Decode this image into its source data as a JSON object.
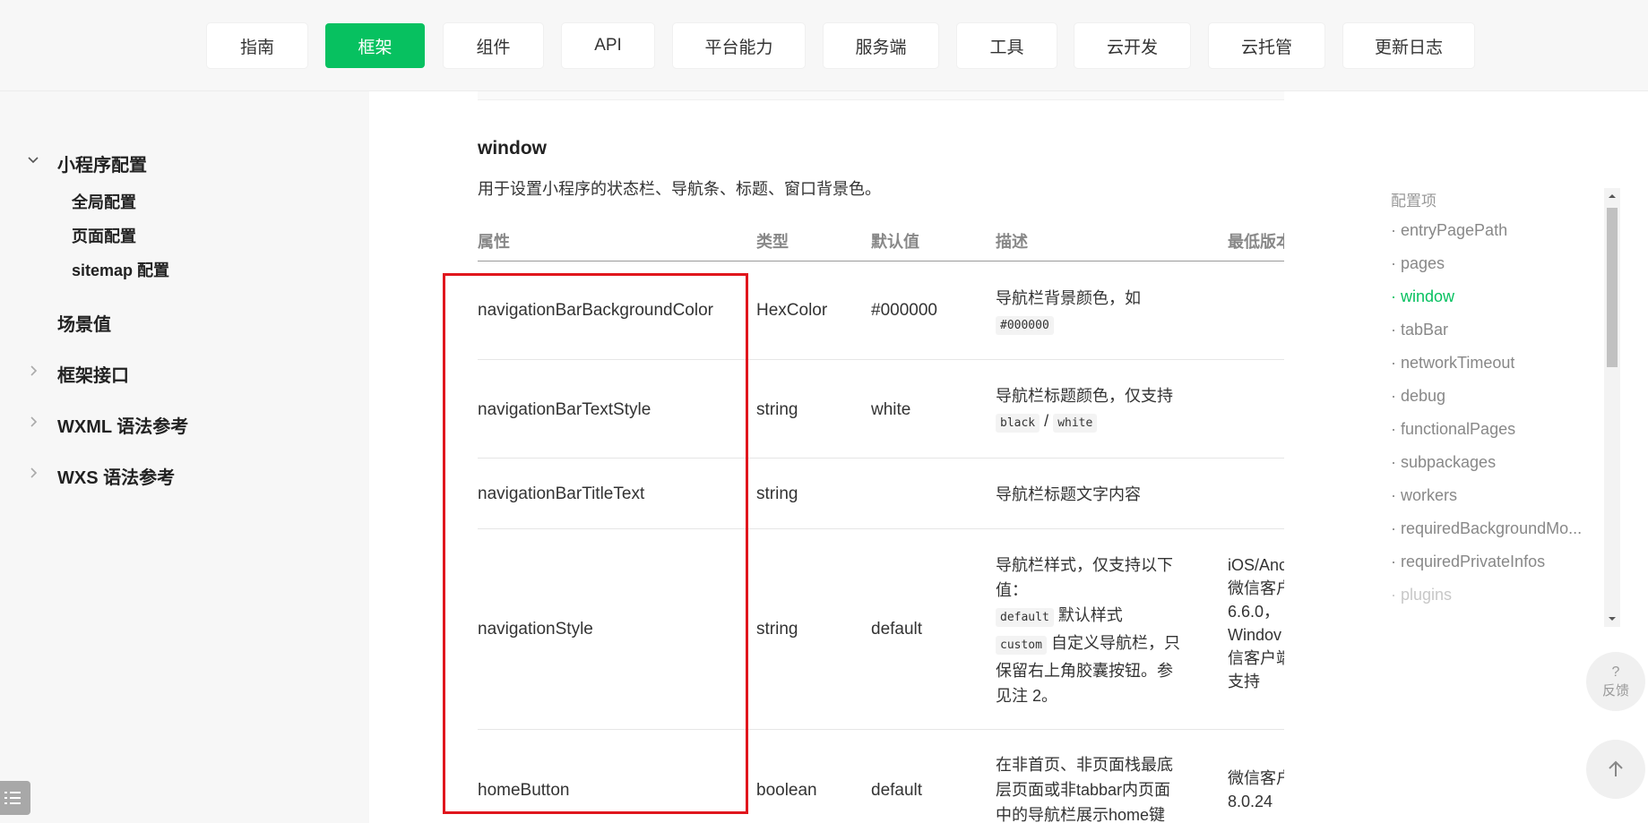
{
  "topnav": {
    "tabs": [
      "指南",
      "框架",
      "组件",
      "API",
      "平台能力",
      "服务端",
      "工具",
      "云开发",
      "云托管",
      "更新日志"
    ],
    "active_tab": "框架",
    "accent_color": "#07c160"
  },
  "sidebar": {
    "group_title": "小程序配置",
    "sub_items": [
      "全局配置",
      "页面配置",
      "sitemap 配置"
    ],
    "items": [
      "场景值",
      "框架接口",
      "WXML 语法参考",
      "WXS 语法参考"
    ]
  },
  "section": {
    "title": "window",
    "description": "用于设置小程序的状态栏、导航条、标题、窗口背景色。"
  },
  "table": {
    "headers": [
      "属性",
      "类型",
      "默认值",
      "描述",
      "最低版本"
    ],
    "rows": [
      {
        "prop": "navigationBarBackgroundColor",
        "type": "HexColor",
        "default": "#000000",
        "desc_text": "导航栏背景颜色，如",
        "desc_code": "#000000"
      },
      {
        "prop": "navigationBarTextStyle",
        "type": "string",
        "default": "white",
        "desc_text": "导航栏标题颜色，仅支持",
        "desc_code1": "black",
        "desc_sep": "/",
        "desc_code2": "white"
      },
      {
        "prop": "navigationBarTitleText",
        "type": "string",
        "default": "",
        "desc_text": "导航栏标题文字内容"
      },
      {
        "prop": "navigationStyle",
        "type": "string",
        "default": "default",
        "desc_line1": "导航栏样式，仅支持以下",
        "desc_line2": "值：",
        "code_default": "default",
        "desc_default": "默认样式",
        "code_custom": "custom",
        "desc_custom": "自定义导航栏，只",
        "desc_line5": "保留右上角胶囊按钮。参",
        "desc_line6": "见注 2。",
        "version_lines": [
          "iOS/Anc",
          "微信客户",
          "6.6.0，",
          "Windov",
          "信客户端",
          "支持"
        ]
      },
      {
        "prop": "homeButton",
        "type": "boolean",
        "default": "default",
        "desc_lines": [
          "在非首页、非页面栈最底",
          "层页面或非tabbar内页面",
          "中的导航栏展示home键"
        ],
        "version_lines": [
          "微信客户",
          "8.0.24"
        ]
      }
    ]
  },
  "toc": {
    "heading": "配置项",
    "items": [
      "· entryPagePath",
      "· pages",
      "· window",
      "· tabBar",
      "· networkTimeout",
      "· debug",
      "· functionalPages",
      "· subpackages",
      "· workers",
      "· requiredBackgroundMo...",
      "· requiredPrivateInfos",
      "· plugins"
    ],
    "active_item": "· window"
  },
  "floating": {
    "feedback_icon": "?",
    "feedback_label": "反馈",
    "back_to_top_icon": "arrow-up-icon"
  },
  "highlight_color": "#e0161d"
}
